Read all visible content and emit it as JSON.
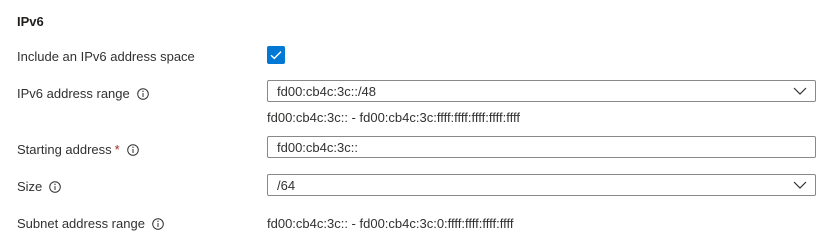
{
  "section": {
    "title": "IPv6"
  },
  "include_ipv6": {
    "label": "Include an IPv6 address space",
    "checked": true
  },
  "ipv6_address_range": {
    "label": "IPv6 address range",
    "value": "fd00:cb4c:3c::/48",
    "range_text": "fd00:cb4c:3c:: - fd00:cb4c:3c:ffff:ffff:ffff:ffff:ffff"
  },
  "starting_address": {
    "label": "Starting address",
    "required_marker": "*",
    "value": "fd00:cb4c:3c::"
  },
  "size": {
    "label": "Size",
    "value": "/64"
  },
  "subnet_address_range": {
    "label": "Subnet address range",
    "value": "fd00:cb4c:3c:: - fd00:cb4c:3c:0:ffff:ffff:ffff:ffff"
  },
  "icons": {
    "info": "info-icon",
    "check": "checkmark-icon",
    "dropdown": "chevron-down-icon"
  },
  "colors": {
    "accent": "#0078d4",
    "required": "#a4262c",
    "border": "#8a8886",
    "text": "#323130"
  }
}
